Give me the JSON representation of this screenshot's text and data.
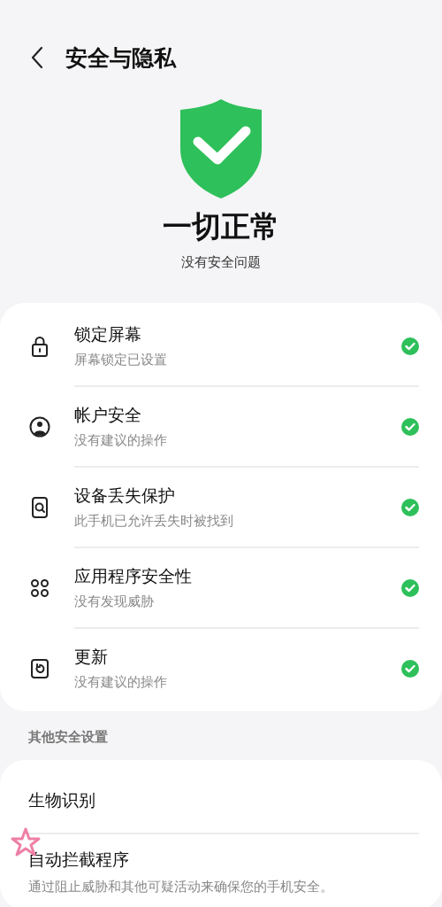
{
  "header": {
    "title": "安全与隐私"
  },
  "status": {
    "title": "一切正常",
    "subtitle": "没有安全问题"
  },
  "items": [
    {
      "kind": "lock",
      "title": "锁定屏幕",
      "subtitle": "屏幕锁定已设置",
      "ok": true
    },
    {
      "kind": "account",
      "title": "帐户安全",
      "subtitle": "没有建议的操作",
      "ok": true
    },
    {
      "kind": "find",
      "title": "设备丢失保护",
      "subtitle": "此手机已允许丢失时被找到",
      "ok": true
    },
    {
      "kind": "apps",
      "title": "应用程序安全性",
      "subtitle": "没有发现威胁",
      "ok": true
    },
    {
      "kind": "update",
      "title": "更新",
      "subtitle": "没有建议的操作",
      "ok": true
    }
  ],
  "other": {
    "heading": "其他安全设置",
    "items": [
      {
        "title": "生物识别"
      },
      {
        "title": "自动拦截程序",
        "subtitle": "通过阻止威胁和其他可疑活动来确保您的手机安全。"
      }
    ]
  }
}
